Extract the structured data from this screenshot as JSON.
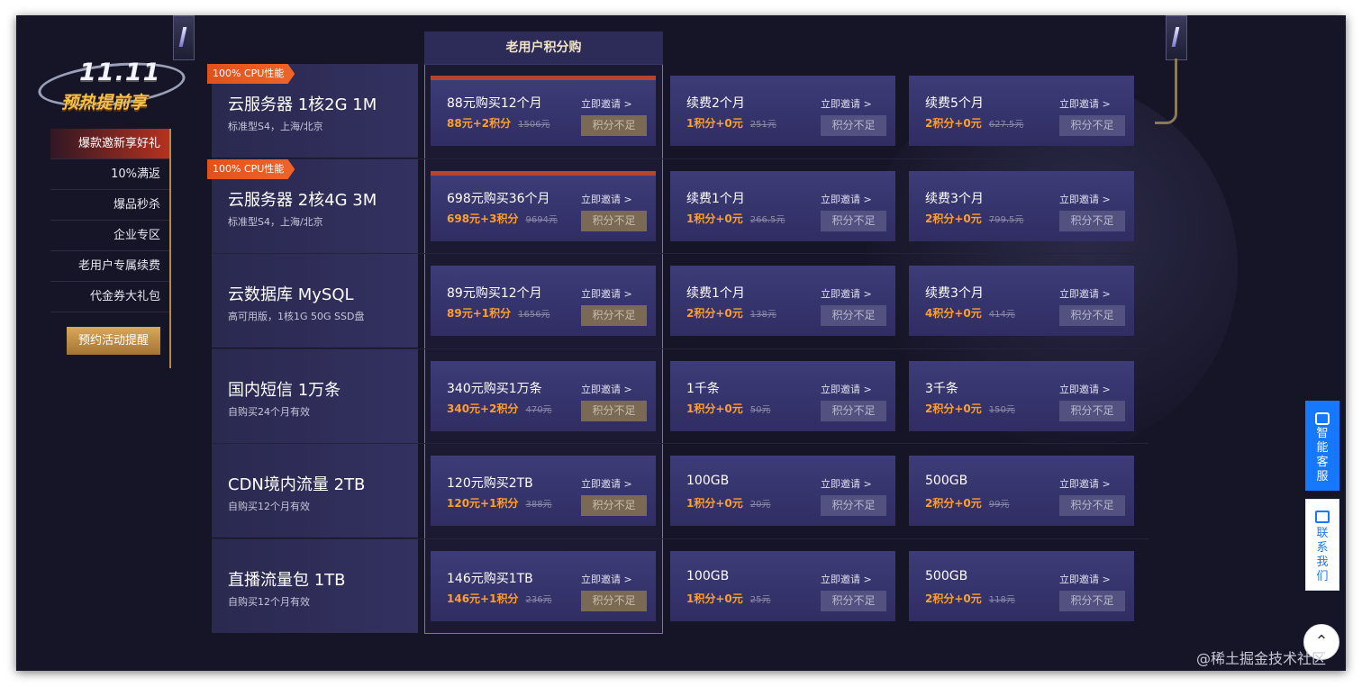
{
  "logo": {
    "line1": "11.11",
    "line2": "预热提前享"
  },
  "nav": {
    "items": [
      {
        "label": "爆款邀新享好礼"
      },
      {
        "label": "10%满返"
      },
      {
        "label": "爆品秒杀"
      },
      {
        "label": "企业专区"
      },
      {
        "label": "老用户专属续费"
      },
      {
        "label": "代金券大礼包"
      }
    ],
    "remind_label": "预约活动提醒"
  },
  "column_title": "老用户积分购",
  "invite_label": "立即邀请 >",
  "insufficient_label": "积分不足",
  "products": [
    {
      "tag": "100% CPU性能",
      "name": "云服务器 1核2G 1M",
      "desc": "标准型S4，上海/北京",
      "cards": [
        {
          "main": "88元购买12个月",
          "price": "88元+2积分",
          "old": "1506元"
        },
        {
          "main": "续费2个月",
          "price": "1积分+0元",
          "old": "251元"
        },
        {
          "main": "续费5个月",
          "price": "2积分+0元",
          "old": "627.5元"
        }
      ]
    },
    {
      "tag": "100% CPU性能",
      "name": "云服务器 2核4G 3M",
      "desc": "标准型S4，上海/北京",
      "cards": [
        {
          "main": "698元购买36个月",
          "price": "698元+3积分",
          "old": "9694元"
        },
        {
          "main": "续费1个月",
          "price": "1积分+0元",
          "old": "266.5元"
        },
        {
          "main": "续费3个月",
          "price": "2积分+0元",
          "old": "799.5元"
        }
      ]
    },
    {
      "tag": "",
      "name": "云数据库 MySQL",
      "desc": "高可用版，1核1G 50G SSD盘",
      "cards": [
        {
          "main": "89元购买12个月",
          "price": "89元+1积分",
          "old": "1656元"
        },
        {
          "main": "续费1个月",
          "price": "2积分+0元",
          "old": "138元"
        },
        {
          "main": "续费3个月",
          "price": "4积分+0元",
          "old": "414元"
        }
      ]
    },
    {
      "tag": "",
      "name": "国内短信 1万条",
      "desc": "自购买24个月有效",
      "cards": [
        {
          "main": "340元购买1万条",
          "price": "340元+2积分",
          "old": "470元"
        },
        {
          "main": "1千条",
          "price": "1积分+0元",
          "old": "50元"
        },
        {
          "main": "3千条",
          "price": "2积分+0元",
          "old": "150元"
        }
      ]
    },
    {
      "tag": "",
      "name": "CDN境内流量 2TB",
      "desc": "自购买12个月有效",
      "cards": [
        {
          "main": "120元购买2TB",
          "price": "120元+1积分",
          "old": "388元"
        },
        {
          "main": "100GB",
          "price": "1积分+0元",
          "old": "20元"
        },
        {
          "main": "500GB",
          "price": "2积分+0元",
          "old": "99元"
        }
      ]
    },
    {
      "tag": "",
      "name": "直播流量包 1TB",
      "desc": "自购买12个月有效",
      "cards": [
        {
          "main": "146元购买1TB",
          "price": "146元+1积分",
          "old": "236元"
        },
        {
          "main": "100GB",
          "price": "1积分+0元",
          "old": "25元"
        },
        {
          "main": "500GB",
          "price": "2积分+0元",
          "old": "118元"
        }
      ]
    }
  ],
  "float": {
    "service": "智能客服",
    "contact": "联系我们",
    "top_icon": "chevron-up-icon"
  },
  "watermark": "@稀土掘金技术社区"
}
